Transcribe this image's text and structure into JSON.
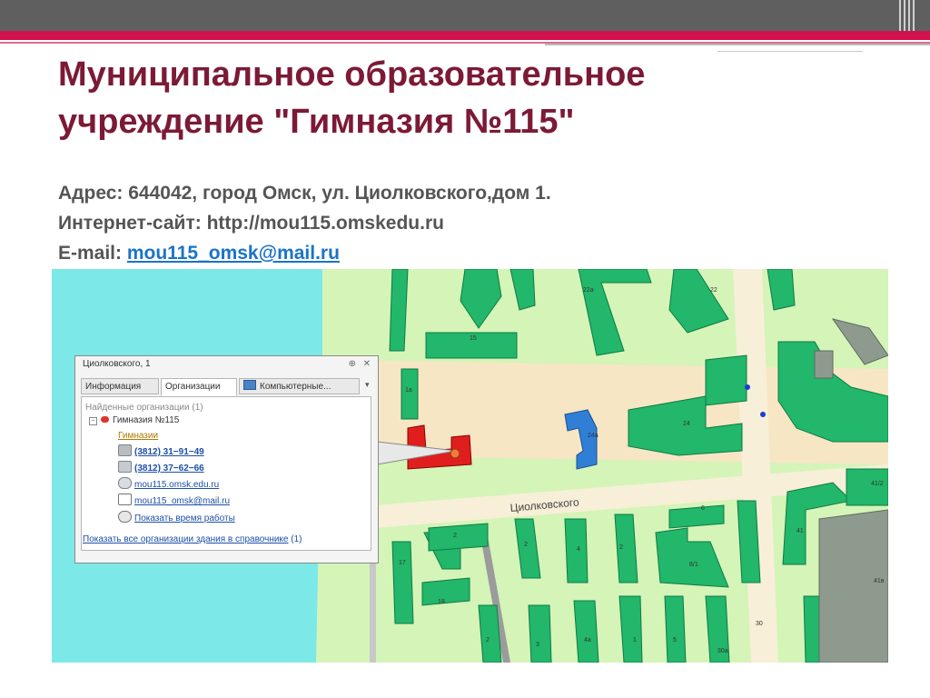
{
  "slide": {
    "title_line1": "Муниципальное образовательное",
    "title_line2": "учреждение \"Гимназия №115\"",
    "address": "Адрес: 644042, город Омск, ул. Циолковского,дом 1.",
    "website": "Интернет-сайт: http://mou115.omskedu.ru",
    "email_label": "E-mail: ",
    "email_link": "mou115_omsk@mail.ru",
    "accent_color": "#d2124e",
    "title_color": "#7c1a36"
  },
  "map": {
    "street_label": "Циолковского",
    "building_numbers": [
      "22а",
      "22",
      "15",
      "1а",
      "24",
      "24а",
      "2",
      "2",
      "6",
      "41/2",
      "41",
      "17",
      "2",
      "4",
      "8/1",
      "18",
      "41в",
      "2",
      "3",
      "4а",
      "5",
      "30",
      "30а",
      "1"
    ],
    "colors": {
      "water": "#7de8e8",
      "land": "#d0f2b4",
      "road": "#f6e8c8",
      "building": "#22b76a",
      "school": "#e01e1e",
      "highlight": "#2f7fd6"
    }
  },
  "popup": {
    "title": "Циолковского, 1",
    "pin_icon": "pin-icon",
    "close_icon": "close-icon",
    "tabs": [
      {
        "label": "Информация",
        "active": false
      },
      {
        "label": "Организации",
        "active": true
      },
      {
        "label": "Компьютерные...",
        "active": false
      }
    ],
    "found_label": "Найденные организации (1)",
    "org_name": "Гимназия №115",
    "category": "Гимназии",
    "phone": "(3812) 31−91−49",
    "fax": "(3812) 37−62−66",
    "website": "mou115.omsk.edu.ru",
    "email": "mou115_omsk@mail.ru",
    "hours_link": "Показать время работы",
    "footer_link": "Показать все организации здания в справочнике",
    "footer_count": "(1)"
  }
}
